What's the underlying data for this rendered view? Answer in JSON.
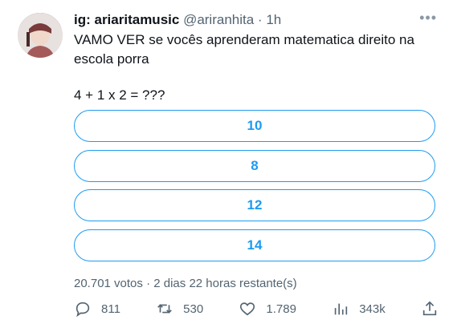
{
  "tweet": {
    "author_name": "ig: ariaritamusic",
    "author_handle": "@ariranhita",
    "separator": " · ",
    "time": "1h",
    "text": "VAMO VER se vocês aprenderam matematica direito na escola porra",
    "question": "4 + 1 x 2 = ???"
  },
  "poll": {
    "options": [
      {
        "label": "10"
      },
      {
        "label": "8"
      },
      {
        "label": "12"
      },
      {
        "label": "14"
      }
    ],
    "votes": "20.701 votos",
    "meta_separator": " · ",
    "time_left": "2 dias 22 horas restante(s)"
  },
  "actions": {
    "replies": "811",
    "retweets": "530",
    "likes": "1.789",
    "views": "343k"
  },
  "colors": {
    "accent": "#1d9bf0",
    "text": "#0f1419",
    "muted": "#536471"
  },
  "icons": [
    "more-icon",
    "reply-icon",
    "retweet-icon",
    "like-icon",
    "views-icon",
    "share-icon"
  ]
}
